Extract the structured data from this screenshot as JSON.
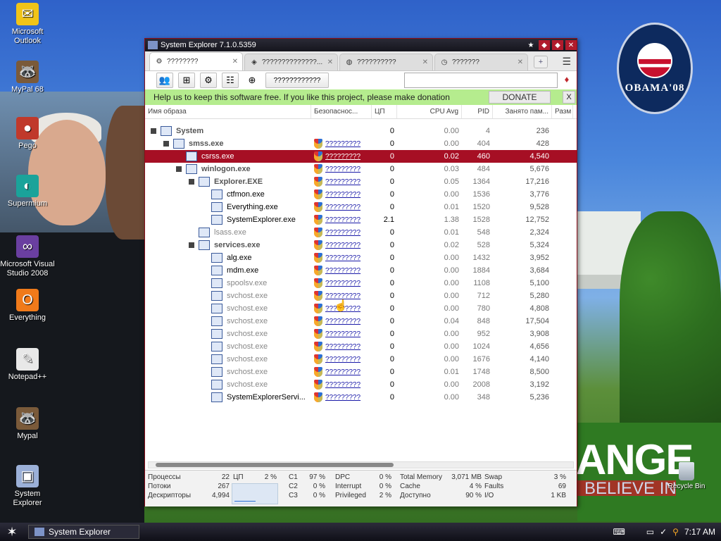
{
  "desktop": {
    "icons": [
      {
        "label": "Microsoft Outlook",
        "icon": "outlook-icon",
        "glyph": "✉"
      },
      {
        "label": "MyPal 68",
        "icon": "raccoon-icon",
        "glyph": "🦝"
      },
      {
        "label": "Pego",
        "icon": "red-ball-icon",
        "glyph": "●"
      },
      {
        "label": "Supermium",
        "icon": "supermium-icon",
        "glyph": "◐"
      },
      {
        "label": "Microsoft Visual Studio 2008",
        "icon": "visual-studio-icon",
        "glyph": "∞"
      },
      {
        "label": "Everything",
        "icon": "everything-icon",
        "glyph": "O"
      },
      {
        "label": "Notepad++",
        "icon": "notepad-icon",
        "glyph": "✎"
      },
      {
        "label": "Mypal",
        "icon": "raccoon-icon",
        "glyph": "🦝"
      },
      {
        "label": "System Explorer",
        "icon": "system-explorer-icon",
        "glyph": "▣"
      }
    ],
    "recycle_bin": "Recycle Bin",
    "wallpaper": {
      "logo_text": "OBAMA'08",
      "slogan_big": "ANGE",
      "slogan_small": "BELIEVE IN"
    }
  },
  "window": {
    "title": "System Explorer 7.1.0.5359",
    "tabs": [
      {
        "label": "????????",
        "icon": "gear-icon"
      },
      {
        "label": "??????????????...",
        "icon": "process-icon"
      },
      {
        "label": "??????????",
        "icon": "globe-icon"
      },
      {
        "label": "???????",
        "icon": "clock-icon"
      }
    ],
    "toolbar": {
      "wide_button": "????????????"
    },
    "donate": {
      "message": "Help us to keep this software free.  If you like this project, please make donation",
      "button": "DONATE",
      "close": "X"
    },
    "columns": [
      "Имя образа",
      "Безопаснос...",
      "ЦП",
      "CPU Avg",
      "PID",
      "Занято пам...",
      "Разм"
    ],
    "processes": [
      {
        "name": "System",
        "level": 0,
        "expand": true,
        "style": "bold",
        "sec": "",
        "cpu": "0",
        "avg": "0.00",
        "pid": "4",
        "mem": "236"
      },
      {
        "name": "smss.exe",
        "level": 1,
        "expand": true,
        "style": "bold",
        "sec": "?????????",
        "cpu": "0",
        "avg": "0.00",
        "pid": "404",
        "mem": "428"
      },
      {
        "name": "csrss.exe",
        "level": 2,
        "expand": false,
        "style": "normal",
        "sec": "?????????",
        "cpu": "0",
        "avg": "0.02",
        "pid": "460",
        "mem": "4,540",
        "selected": true
      },
      {
        "name": "winlogon.exe",
        "level": 2,
        "expand": true,
        "style": "bold",
        "sec": "?????????",
        "cpu": "0",
        "avg": "0.03",
        "pid": "484",
        "mem": "5,676"
      },
      {
        "name": "Explorer.EXE",
        "level": 3,
        "expand": true,
        "style": "bold",
        "sec": "?????????",
        "cpu": "0",
        "avg": "0.05",
        "pid": "1364",
        "mem": "17,216"
      },
      {
        "name": "ctfmon.exe",
        "level": 4,
        "expand": false,
        "style": "normal",
        "sec": "?????????",
        "cpu": "0",
        "avg": "0.00",
        "pid": "1536",
        "mem": "3,776"
      },
      {
        "name": "Everything.exe",
        "level": 4,
        "expand": false,
        "style": "normal",
        "sec": "?????????",
        "cpu": "0",
        "avg": "0.01",
        "pid": "1520",
        "mem": "9,528"
      },
      {
        "name": "SystemExplorer.exe",
        "level": 4,
        "expand": false,
        "style": "normal",
        "sec": "?????????",
        "cpu": "2.1",
        "avg": "1.38",
        "pid": "1528",
        "mem": "12,752"
      },
      {
        "name": "lsass.exe",
        "level": 3,
        "expand": false,
        "style": "gray",
        "sec": "?????????",
        "cpu": "0",
        "avg": "0.01",
        "pid": "548",
        "mem": "2,324"
      },
      {
        "name": "services.exe",
        "level": 3,
        "expand": true,
        "style": "bold",
        "sec": "?????????",
        "cpu": "0",
        "avg": "0.02",
        "pid": "528",
        "mem": "5,324"
      },
      {
        "name": "alg.exe",
        "level": 4,
        "expand": false,
        "style": "normal",
        "sec": "?????????",
        "cpu": "0",
        "avg": "0.00",
        "pid": "1432",
        "mem": "3,952"
      },
      {
        "name": "mdm.exe",
        "level": 4,
        "expand": false,
        "style": "normal",
        "sec": "?????????",
        "cpu": "0",
        "avg": "0.00",
        "pid": "1884",
        "mem": "3,684"
      },
      {
        "name": "spoolsv.exe",
        "level": 4,
        "expand": false,
        "style": "gray",
        "sec": "?????????",
        "cpu": "0",
        "avg": "0.00",
        "pid": "1108",
        "mem": "5,100"
      },
      {
        "name": "svchost.exe",
        "level": 4,
        "expand": false,
        "style": "gray",
        "sec": "?????????",
        "cpu": "0",
        "avg": "0.00",
        "pid": "712",
        "mem": "5,280"
      },
      {
        "name": "svchost.exe",
        "level": 4,
        "expand": false,
        "style": "gray",
        "sec": "?????????",
        "cpu": "0",
        "avg": "0.00",
        "pid": "780",
        "mem": "4,808"
      },
      {
        "name": "svchost.exe",
        "level": 4,
        "expand": false,
        "style": "gray",
        "sec": "?????????",
        "cpu": "0",
        "avg": "0.04",
        "pid": "848",
        "mem": "17,504"
      },
      {
        "name": "svchost.exe",
        "level": 4,
        "expand": false,
        "style": "gray",
        "sec": "?????????",
        "cpu": "0",
        "avg": "0.00",
        "pid": "952",
        "mem": "3,908"
      },
      {
        "name": "svchost.exe",
        "level": 4,
        "expand": false,
        "style": "gray",
        "sec": "?????????",
        "cpu": "0",
        "avg": "0.00",
        "pid": "1024",
        "mem": "4,656"
      },
      {
        "name": "svchost.exe",
        "level": 4,
        "expand": false,
        "style": "gray",
        "sec": "?????????",
        "cpu": "0",
        "avg": "0.00",
        "pid": "1676",
        "mem": "4,140"
      },
      {
        "name": "svchost.exe",
        "level": 4,
        "expand": false,
        "style": "gray",
        "sec": "?????????",
        "cpu": "0",
        "avg": "0.01",
        "pid": "1748",
        "mem": "8,500"
      },
      {
        "name": "svchost.exe",
        "level": 4,
        "expand": false,
        "style": "gray",
        "sec": "?????????",
        "cpu": "0",
        "avg": "0.00",
        "pid": "2008",
        "mem": "3,192"
      },
      {
        "name": "SystemExplorerServi...",
        "level": 4,
        "expand": false,
        "style": "normal",
        "sec": "?????????",
        "cpu": "0",
        "avg": "0.00",
        "pid": "348",
        "mem": "5,236"
      }
    ],
    "stats": {
      "procs_label": "Процессы",
      "procs_val": "22",
      "threads_label": "Потоки",
      "threads_val": "267",
      "handles_label": "Дескрипторы",
      "handles_val": "4,994",
      "cpu_label": "ЦП",
      "cpu_val": "2 %",
      "c1_label": "C1",
      "c1_val": "97 %",
      "c2_label": "C2",
      "c2_val": "0 %",
      "c3_label": "C3",
      "c3_val": "0 %",
      "dpc_label": "DPC",
      "dpc_val": "0 %",
      "interrupt_label": "Interrupt",
      "interrupt_val": "0 %",
      "privileged_label": "Privileged",
      "privileged_val": "2 %",
      "totalmem_label": "Total Memory",
      "totalmem_val": "3,071 MB",
      "cache_label": "Cache",
      "cache_val": "4 %",
      "avail_label": "Доступно",
      "avail_val": "90 %",
      "swap_label": "Swap",
      "swap_val": "3 %",
      "faults_label": "Faults",
      "faults_val": "69",
      "io_label": "I/O",
      "io_val": "1 KB"
    }
  },
  "taskbar": {
    "task_label": "System Explorer",
    "clock": "7:17 AM"
  },
  "colors": {
    "selection": "#a60f24",
    "donate_bar": "#b5ec8e",
    "link": "#1a1aa8"
  }
}
